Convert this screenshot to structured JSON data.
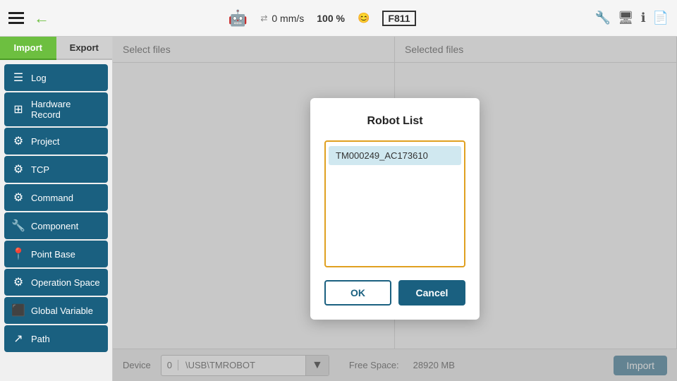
{
  "topbar": {
    "speed": "0 mm/s",
    "percent": "100 %",
    "badge": "F811"
  },
  "sidebar": {
    "tab_import": "Import",
    "tab_export": "Export",
    "items": [
      {
        "id": "log",
        "label": "Log",
        "icon": "☰"
      },
      {
        "id": "hardware-record",
        "label": "Hardware Record",
        "icon": "⊞"
      },
      {
        "id": "project",
        "label": "Project",
        "icon": "⚙"
      },
      {
        "id": "tcp",
        "label": "TCP",
        "icon": "⚙"
      },
      {
        "id": "command",
        "label": "Command",
        "icon": "⚙"
      },
      {
        "id": "component",
        "label": "Component",
        "icon": "🔧"
      },
      {
        "id": "point-base",
        "label": "Point Base",
        "icon": "📍"
      },
      {
        "id": "operation-space",
        "label": "Operation Space",
        "icon": "⚙"
      },
      {
        "id": "global-variable",
        "label": "Global Variable",
        "icon": "⬛"
      },
      {
        "id": "path",
        "label": "Path",
        "icon": "↗"
      }
    ]
  },
  "file_panel": {
    "select_files_label": "Select files",
    "selected_files_label": "Selected files"
  },
  "bottom_bar": {
    "device_label": "Device",
    "device_number": "0",
    "device_path": "\\USB\\TMROBOT",
    "freespace_label": "Free Space:",
    "freespace_value": "28920 MB",
    "import_btn": "Import"
  },
  "dialog": {
    "title": "Robot List",
    "robot_item": "TM000249_AC173610",
    "ok_label": "OK",
    "cancel_label": "Cancel"
  }
}
